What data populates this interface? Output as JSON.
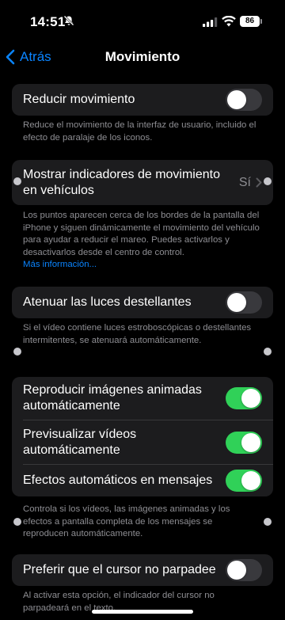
{
  "status_bar": {
    "time": "14:51",
    "battery": "86"
  },
  "nav": {
    "back_label": "Atrás",
    "title": "Movimiento"
  },
  "sections": {
    "reduce_motion": {
      "label": "Reducir movimiento",
      "toggle": "off",
      "footer": "Reduce el movimiento de la interfaz de usuario, incluido el efecto de paralaje de los iconos."
    },
    "vehicle_cues": {
      "label": "Mostrar indicadores de movimiento en vehículos",
      "value": "Sí",
      "footer": "Los puntos aparecen cerca de los bordes de la pantalla del iPhone y siguen dinámicamente el movimiento del vehículo para ayudar a reducir el mareo. Puedes activarlos y desactivarlos desde el centro de control.",
      "footer_link": "Más información..."
    },
    "dim_flashing": {
      "label": "Atenuar las luces destellantes",
      "toggle": "off",
      "footer": "Si el vídeo contiene luces estroboscópicas o destellantes intermitentes, se atenuará automáticamente."
    },
    "autoplay": {
      "rows": [
        {
          "label": "Reproducir imágenes animadas automáticamente",
          "toggle": "on"
        },
        {
          "label": "Previsualizar vídeos automáticamente",
          "toggle": "on"
        },
        {
          "label": "Efectos automáticos en mensajes",
          "toggle": "on"
        }
      ],
      "footer": "Controla si los vídeos, las imágenes animadas y los efectos a pantalla completa de los mensajes se reproducen automáticamente."
    },
    "cursor": {
      "label": "Preferir que el cursor no parpadee",
      "toggle": "off",
      "footer": "Al activar esta opción, el indicador del cursor no parpadeará en el texto."
    }
  },
  "colors": {
    "accent": "#0a84ff",
    "toggle_on": "#30d158",
    "card": "#1c1c1e",
    "secondary_text": "#8e8e93"
  },
  "icons": [
    "bell-slash-icon",
    "signal-icon",
    "wifi-icon",
    "battery-icon",
    "back-chevron-icon",
    "chevron-right-icon"
  ]
}
